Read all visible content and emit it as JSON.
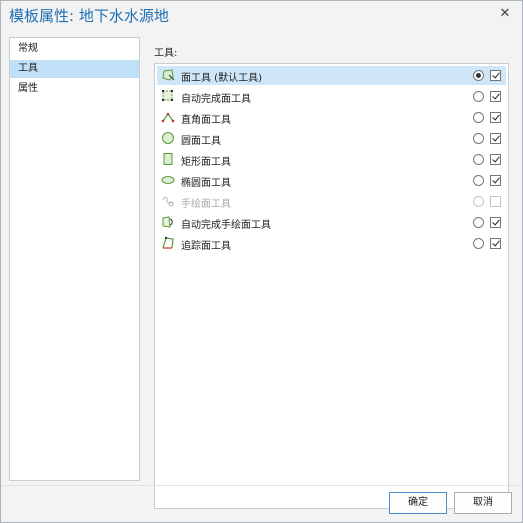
{
  "dialog": {
    "title": "模板属性: 地下水水源地",
    "close_symbol": "✕"
  },
  "nav": {
    "items": [
      {
        "label": "常规",
        "selected": false
      },
      {
        "label": "工具",
        "selected": true
      },
      {
        "label": "属性",
        "selected": false
      }
    ]
  },
  "tools": {
    "section_label": "工具:",
    "items": [
      {
        "label": "面工具 (默认工具)",
        "icon": "polygon-tool-icon",
        "default": true,
        "enabled": true,
        "disabled": false,
        "selected": true
      },
      {
        "label": "自动完成面工具",
        "icon": "autocomplete-polygon-icon",
        "default": false,
        "enabled": true,
        "disabled": false,
        "selected": false
      },
      {
        "label": "直角面工具",
        "icon": "right-angle-polygon-icon",
        "default": false,
        "enabled": true,
        "disabled": false,
        "selected": false
      },
      {
        "label": "圆面工具",
        "icon": "circle-polygon-icon",
        "default": false,
        "enabled": true,
        "disabled": false,
        "selected": false
      },
      {
        "label": "矩形面工具",
        "icon": "rectangle-polygon-icon",
        "default": false,
        "enabled": true,
        "disabled": false,
        "selected": false
      },
      {
        "label": "椭圆面工具",
        "icon": "ellipse-polygon-icon",
        "default": false,
        "enabled": true,
        "disabled": false,
        "selected": false
      },
      {
        "label": "手绘面工具",
        "icon": "freehand-polygon-icon",
        "default": false,
        "enabled": false,
        "disabled": true,
        "selected": false
      },
      {
        "label": "自动完成手绘面工具",
        "icon": "autocomplete-freehand-icon",
        "default": false,
        "enabled": true,
        "disabled": false,
        "selected": false
      },
      {
        "label": "追踪面工具",
        "icon": "trace-polygon-icon",
        "default": false,
        "enabled": true,
        "disabled": false,
        "selected": false
      }
    ]
  },
  "buttons": {
    "ok_label": "确定",
    "cancel_label": "取消"
  },
  "colors": {
    "title": "#1f6fb4",
    "selection": "#bfe0f7",
    "icon_green": "#5a9a3a"
  }
}
